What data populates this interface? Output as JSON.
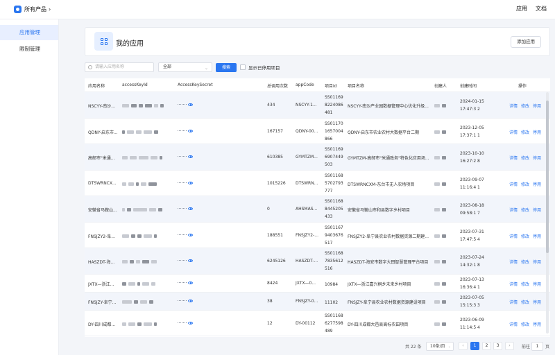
{
  "header": {
    "app_switch": "所有产品",
    "nav": [
      "应用",
      "文档"
    ]
  },
  "sidebar": {
    "items": [
      {
        "label": "应用管理",
        "active": true
      },
      {
        "label": "限制管理",
        "active": false
      }
    ]
  },
  "page": {
    "title": "我的应用",
    "add_button": "添加应用"
  },
  "filters": {
    "search_placeholder": "请输入应用名称",
    "status_select": "全部",
    "search_button": "搜索",
    "show_stopped": "显示已停用项目"
  },
  "table": {
    "columns": [
      "应用名称",
      "accessKeyId",
      "AccessKeySecret",
      "总调用次数",
      "appCode",
      "项目id",
      "项目名称",
      "创建人",
      "创建时间",
      "操作"
    ],
    "actions": [
      "详情",
      "修改",
      "停用"
    ],
    "rows": [
      {
        "name": "NSCYY-南沙...",
        "calls": "434",
        "app_code": "NSCYY-1...",
        "project_id": "SS01169 8224086 481",
        "project_name": "NSCYY-南沙产业园数据管理中心优化升级...",
        "created": "2024-01-15 17:47:3 2"
      },
      {
        "name": "QDNY-启东市...",
        "calls": "167157",
        "app_code": "QDNY-00...",
        "project_id": "SS01170 1657004 866",
        "project_name": "QDNY-启东市农业农村大数据平台二期",
        "created": "2023-12-05 17:37:1 1"
      },
      {
        "name": "高邮市\"米通...",
        "calls": "610385",
        "app_code": "GYMTZM...",
        "project_id": "SS01169 6907449 503",
        "project_name": "GYMTZM-高邮市\"米通政务\"特色化应用场...",
        "created": "2023-10-10 16:27:2 8"
      },
      {
        "name": "DTSWRNCX...",
        "calls": "1015226",
        "app_code": "DTSWRN...",
        "project_id": "SS01168 5702793 777",
        "project_name": "DTSWRNCXM-东台市无人农场项目",
        "created": "2023-09-07 11:16:4 1"
      },
      {
        "name": "安徽省马鞍山...",
        "calls": "0",
        "app_code": "AHSMAS...",
        "project_id": "SS01168 8445205 433",
        "project_name": "安徽省马鞍山市和县数字乡村项目",
        "created": "2023-08-18 09:58:1 7"
      },
      {
        "name": "FNSJZY2-阜...",
        "calls": "188551",
        "app_code": "FNSJZY2-...",
        "project_id": "SS01167 9403676 517",
        "project_name": "FNSJZY2-阜宁县农业农村数据资源二期建...",
        "created": "2023-07-31 17:47:5 4"
      },
      {
        "name": "HASZDT-海...",
        "calls": "6245126",
        "app_code": "HASZDT-...",
        "project_id": "SS01168 7835612 516",
        "project_name": "HASZDT-海安市数字大田智慧管理平台项目",
        "created": "2023-07-24 14:32:1 8"
      },
      {
        "name": "JXTX—浙江...",
        "calls": "8424",
        "app_code": "JXTX—0...",
        "project_id": "10984",
        "project_name": "JXTX—浙江嘉兴桐乡未来乡村项目",
        "created": "2023-07-13 16:36:4 1"
      },
      {
        "name": "FNSJZY-阜宁...",
        "calls": "38",
        "app_code": "FNSJZY-0...",
        "project_id": "11102",
        "project_name": "FNSJZY-阜宁县农业农村数据资源建设项目",
        "created": "2023-07-05 15:15:3 3"
      },
      {
        "name": "DY-四川成都...",
        "calls": "12",
        "app_code": "DY-00112",
        "project_id": "SS01168 6277598 489",
        "project_name": "DY-四川成都大邑县高标农田项目",
        "created": "2023-06-09 11:14:5 4"
      }
    ]
  },
  "pagination": {
    "total": "共 22 条",
    "page_size": "10条/页",
    "pages": [
      "1",
      "2",
      "3"
    ],
    "current": "1",
    "goto_label": "前往",
    "goto_value": "1",
    "goto_suffix": "页"
  },
  "colors": {
    "accent": "#2a76f0",
    "row_alt": "#f2f5fb"
  }
}
